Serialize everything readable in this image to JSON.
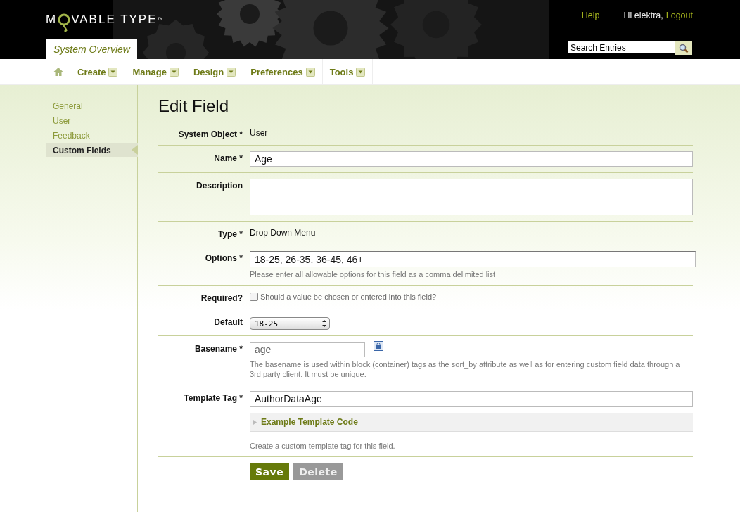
{
  "header": {
    "logo": {
      "before": "M",
      "after": "VABLE TYPE",
      "mark": "™"
    },
    "help": "Help",
    "greeting": "Hi elektra,",
    "logout": "Logout",
    "scope_tab": "System Overview",
    "search": {
      "value": "Search Entries"
    }
  },
  "nav": [
    {
      "label": "Create"
    },
    {
      "label": "Manage"
    },
    {
      "label": "Design"
    },
    {
      "label": "Preferences"
    },
    {
      "label": "Tools"
    }
  ],
  "sidebar": {
    "items": [
      {
        "label": "General",
        "selected": false
      },
      {
        "label": "User",
        "selected": false
      },
      {
        "label": "Feedback",
        "selected": false
      },
      {
        "label": "Custom Fields",
        "selected": true
      }
    ]
  },
  "title": "Edit Field",
  "fields": [
    {
      "kind": "static",
      "label": "System Object *",
      "value": "User"
    },
    {
      "kind": "input",
      "label": "Name *",
      "value": "Age"
    },
    {
      "kind": "textarea",
      "label": "Description"
    },
    {
      "kind": "static",
      "label": "Type *",
      "value": "Drop Down Menu"
    },
    {
      "kind": "input",
      "label": "Options *",
      "value": "18-25, 26-35. 36-45, 46+",
      "hint": "Please enter all allowable options for this field as a comma delimited list"
    },
    {
      "kind": "checkbox",
      "label": "Required?",
      "text": "Should a value be chosen or entered into this field?",
      "checked": false
    },
    {
      "kind": "select",
      "label": "Default",
      "value": "18-25"
    },
    {
      "kind": "basename",
      "label": "Basename *",
      "value": "age",
      "locked": true,
      "hint": "The basename is used within block (container) tags as the sort_by attribute as well as for entering custom field data through a 3rd party client. It must be unique."
    },
    {
      "kind": "tag",
      "label": "Template Tag *",
      "value": "AuthorDataAge",
      "expander": {
        "label": "Example Template Code",
        "expanded": false
      },
      "hint": "Create a custom template tag for this field."
    }
  ],
  "buttons": [
    {
      "label": "Save",
      "disabled": false
    },
    {
      "label": "Delete",
      "disabled": true
    }
  ]
}
